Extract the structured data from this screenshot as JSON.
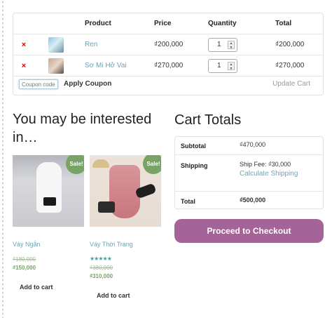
{
  "cart": {
    "headers": {
      "product": "Product",
      "price": "Price",
      "quantity": "Quantity",
      "total": "Total"
    },
    "items": [
      {
        "remove_icon": "×",
        "thumb": "product-thumbnail",
        "name": "Ren",
        "price": "₫200,000",
        "quantity": "1",
        "total": "₫200,000"
      },
      {
        "remove_icon": "×",
        "thumb": "product-thumbnail",
        "name": "Sơ Mi Hở Vai",
        "price": "₫270,000",
        "quantity": "1",
        "total": "₫270,000"
      }
    ],
    "coupon_placeholder": "Coupon code",
    "apply_coupon": "Apply Coupon",
    "update_cart": "Update Cart"
  },
  "related": {
    "title": "You may be interested in…",
    "products": [
      {
        "name": "Váy Ngắn",
        "badge": "Sale!",
        "old_price": "₫180,000",
        "new_price": "₫150,000",
        "rating_stars": "",
        "add_to_cart": "Add to cart"
      },
      {
        "name": "Váy Thời Trang",
        "badge": "Sale!",
        "old_price": "₫380,000",
        "new_price": "₫310,000",
        "rating_stars": "★★★★★",
        "add_to_cart": "Add to cart"
      }
    ]
  },
  "totals": {
    "title": "Cart Totals",
    "subtotal_label": "Subtotal",
    "subtotal_value": "₫470,000",
    "shipping_label": "Shipping",
    "shipping_fee": "Ship Fee: ₫30,000",
    "calculate_shipping": "Calculate Shipping",
    "total_label": "Total",
    "total_value": "₫500,000",
    "checkout_label": "Proceed to Checkout"
  },
  "colors": {
    "accent": "#a46497",
    "sale_badge": "#77a464",
    "link": "#6fa4b3",
    "remove": "#e10000"
  }
}
